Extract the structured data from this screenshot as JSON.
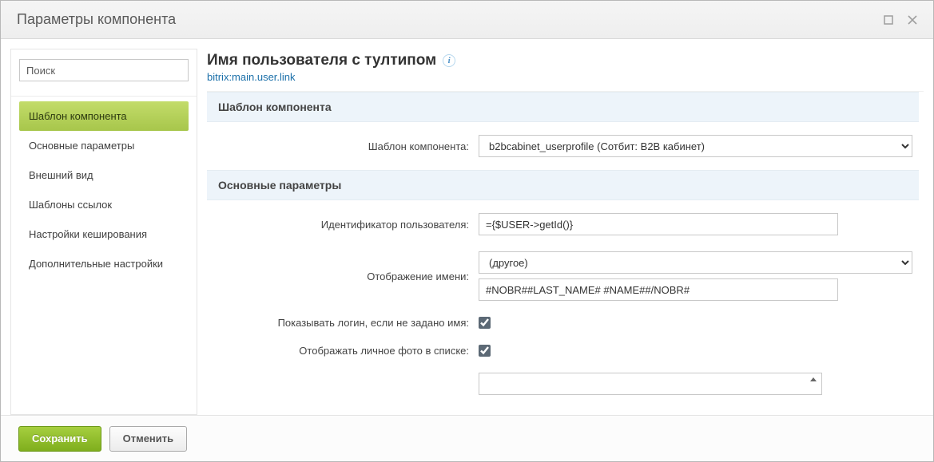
{
  "window": {
    "title": "Параметры компонента"
  },
  "search": {
    "placeholder": "Поиск"
  },
  "nav": {
    "items": [
      {
        "label": "Шаблон компонента",
        "active": true
      },
      {
        "label": "Основные параметры",
        "active": false
      },
      {
        "label": "Внешний вид",
        "active": false
      },
      {
        "label": "Шаблоны ссылок",
        "active": false
      },
      {
        "label": "Настройки кеширования",
        "active": false
      },
      {
        "label": "Дополнительные настройки",
        "active": false
      }
    ]
  },
  "header": {
    "title": "Имя пользователя с тултипом",
    "subtitle": "bitrix:main.user.link"
  },
  "sections": {
    "template": {
      "title": "Шаблон компонента",
      "rows": {
        "template": {
          "label": "Шаблон компонента:",
          "value": "b2bcabinet_userprofile (Сотбит: B2B кабинет)"
        }
      }
    },
    "main": {
      "title": "Основные параметры",
      "rows": {
        "user_id": {
          "label": "Идентификатор пользователя:",
          "value": "={$USER->getId()}"
        },
        "name_display": {
          "label": "Отображение имени:",
          "select_value": "(другое)",
          "text_value": "#NOBR##LAST_NAME# #NAME##/NOBR#"
        },
        "show_login": {
          "label": "Показывать логин, если не задано имя:",
          "checked": true
        },
        "show_photo": {
          "label": "Отображать личное фото в списке:",
          "checked": true
        }
      }
    }
  },
  "footer": {
    "save": "Сохранить",
    "cancel": "Отменить"
  }
}
